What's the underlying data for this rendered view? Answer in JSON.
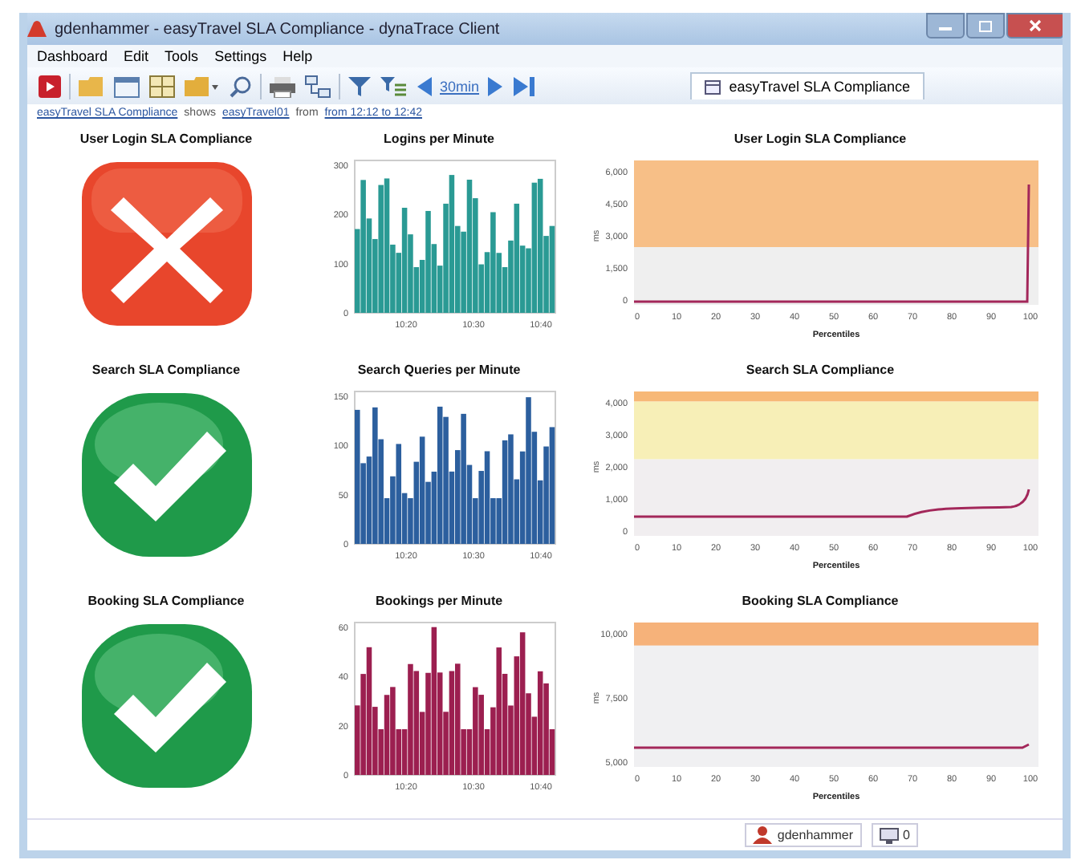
{
  "window": {
    "title": "gdenhammer - easyTravel SLA Compliance - dynaTrace Client"
  },
  "menu": [
    "Dashboard",
    "Edit",
    "Tools",
    "Settings",
    "Help"
  ],
  "toolbar": {
    "timeframe": "30min"
  },
  "tab": {
    "label": "easyTravel SLA Compliance"
  },
  "breadcrumb": [
    {
      "text": "easyTravel SLA Compliance",
      "link": true
    },
    {
      "text": "shows",
      "link": false
    },
    {
      "text": "easyTravel01",
      "link": true
    },
    {
      "text": "from",
      "link": false
    },
    {
      "text": "from 12:12 to 12:42",
      "link": true
    }
  ],
  "rows": [
    {
      "kind": "fail",
      "title": "User Login SLA Compliance",
      "rate": {
        "title": "Logins per Minute",
        "color": "#2a9a94",
        "yticks": [
          "300",
          "200",
          "100",
          "0"
        ],
        "xticks": [
          "10:20",
          "10:30",
          "10:40"
        ]
      },
      "sla": {
        "kind": "spike",
        "title": "User Login SLA Compliance",
        "ylabel": "ms",
        "xlabel": "Percentiles",
        "yticks": [
          "6,000",
          "4,500",
          "3,000",
          "1,500",
          "0"
        ],
        "xticks": [
          "0",
          "10",
          "20",
          "30",
          "40",
          "50",
          "60",
          "70",
          "80",
          "90",
          "100"
        ]
      }
    },
    {
      "kind": "ok",
      "title": "Search SLA Compliance",
      "rate": {
        "title": "Search Queries per Minute",
        "color": "#2c5f9e",
        "yticks": [
          "150",
          "100",
          "50",
          "0"
        ],
        "xticks": [
          "10:20",
          "10:30",
          "10:40"
        ]
      },
      "sla": {
        "kind": "rising",
        "title": "Search SLA Compliance",
        "ylabel": "ms",
        "xlabel": "Percentiles",
        "yticks": [
          "4,000",
          "3,000",
          "2,000",
          "1,000",
          "0"
        ],
        "xticks": [
          "0",
          "10",
          "20",
          "30",
          "40",
          "50",
          "60",
          "70",
          "80",
          "90",
          "100"
        ]
      }
    },
    {
      "kind": "ok",
      "title": "Booking SLA Compliance",
      "rate": {
        "title": "Bookings per Minute",
        "color": "#9c1f50",
        "yticks": [
          "60",
          "40",
          "20",
          "0"
        ],
        "xticks": [
          "10:20",
          "10:30",
          "10:40"
        ]
      },
      "sla": {
        "kind": "flat",
        "title": "Booking SLA Compliance",
        "ylabel": "ms",
        "xlabel": "Percentiles",
        "yticks": [
          "10,000",
          "7,500",
          "5,000"
        ],
        "xticks": [
          "0",
          "10",
          "20",
          "30",
          "40",
          "50",
          "60",
          "70",
          "80",
          "90",
          "100"
        ]
      }
    }
  ],
  "status_bar": {
    "user": "gdenhammer",
    "count": "0"
  }
}
